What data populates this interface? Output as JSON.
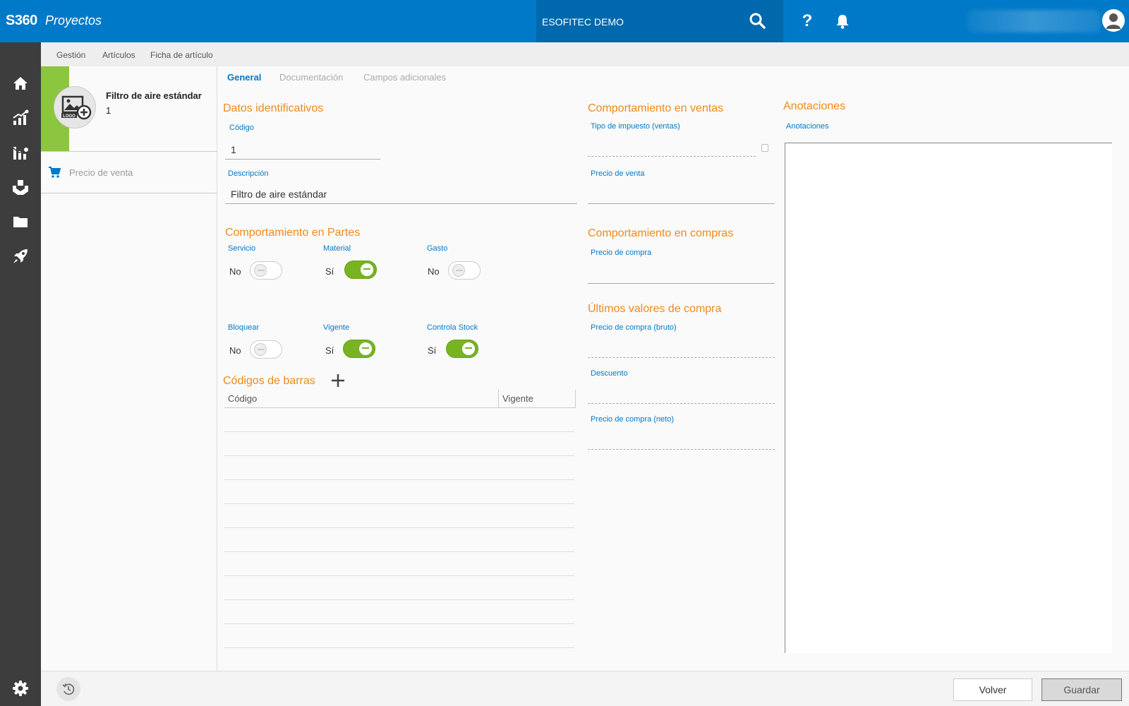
{
  "header": {
    "brand": "S360",
    "module": "Proyectos",
    "company": "ESOFITEC DEMO",
    "help_glyph": "?"
  },
  "breadcrumb": [
    "Gestión",
    "Artículos",
    "Ficha de artículo"
  ],
  "item": {
    "name": "Filtro de aire estándar",
    "code": "1"
  },
  "left_panel": {
    "price_link": "Precio de venta"
  },
  "tabs": [
    "General",
    "Documentación",
    "Campos adicionales"
  ],
  "ident": {
    "title": "Datos identificativos",
    "code_label": "Código",
    "code_value": "1",
    "desc_label": "Descripción",
    "desc_value": "Filtro de aire estándar"
  },
  "parts": {
    "title": "Comportamiento en Partes",
    "toggles": [
      {
        "label": "Servicio",
        "state": "No",
        "on": false
      },
      {
        "label": "Material",
        "state": "Sí",
        "on": true
      },
      {
        "label": "Gasto",
        "state": "No",
        "on": false
      },
      {
        "label": "Bloquear",
        "state": "No",
        "on": false
      },
      {
        "label": "Vigente",
        "state": "Sí",
        "on": true
      },
      {
        "label": "Controla Stock",
        "state": "Sí",
        "on": true
      }
    ]
  },
  "barcodes": {
    "title": "Códigos de barras",
    "columns": [
      "Código",
      "Vigente"
    ]
  },
  "sales": {
    "title": "Comportamiento en ventas",
    "tax_label": "Tipo de impuesto (ventas)",
    "price_label": "Precio de venta"
  },
  "purchases": {
    "title": "Comportamiento en compras",
    "price_label": "Precio de compra"
  },
  "last_purchase": {
    "title": "Últimos valores de compra",
    "gross_label": "Precio de compra (bruto)",
    "discount_label": "Descuento",
    "net_label": "Precio de compra (neto)"
  },
  "notes": {
    "title": "Anotaciones",
    "label": "Anotaciones"
  },
  "footer": {
    "back": "Volver",
    "save": "Guardar"
  },
  "colors": {
    "primary": "#0079c8",
    "accent_orange": "#ef8a1b",
    "toggle_on": "#78b321",
    "sidebar": "#3d3d3d",
    "item_strip": "#8cc63f"
  }
}
